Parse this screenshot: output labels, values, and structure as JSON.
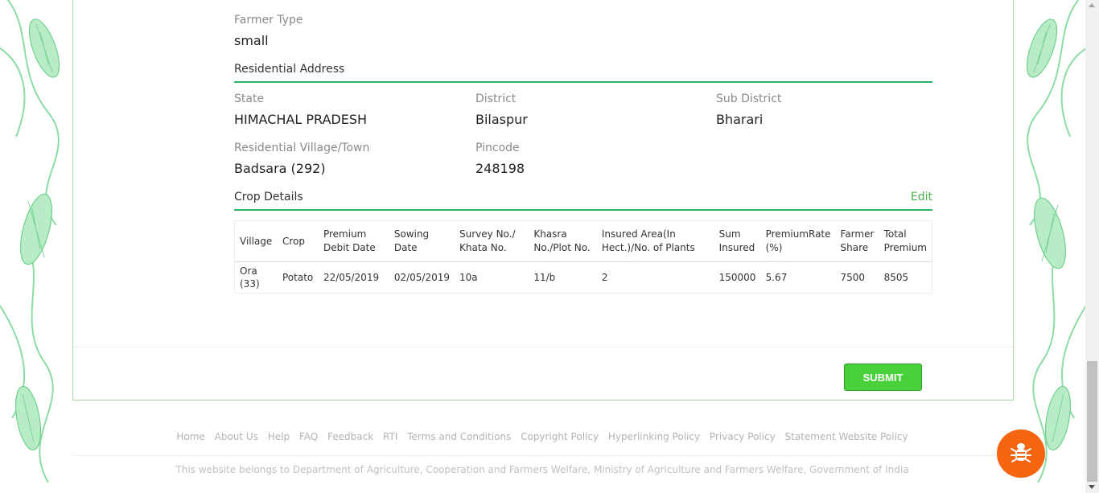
{
  "farmer": {
    "type_label": "Farmer Type",
    "type_value": "small"
  },
  "residential": {
    "title": "Residential Address",
    "state_label": "State",
    "state_value": "HIMACHAL PRADESH",
    "district_label": "District",
    "district_value": "Bilaspur",
    "subdistrict_label": "Sub District",
    "subdistrict_value": "Bharari",
    "village_label": "Residential Village/Town",
    "village_value": "Badsara (292)",
    "pincode_label": "Pincode",
    "pincode_value": "248198"
  },
  "crop": {
    "title": "Crop Details",
    "edit_label": "Edit",
    "headers": [
      "Village",
      "Crop",
      "Premium Debit Date",
      "Sowing Date",
      "Survey No./ Khata No.",
      "Khasra No./Plot No.",
      "Insured Area(In Hect.)/No. of Plants",
      "Sum Insured",
      "PremiumRate (%)",
      "Farmer Share",
      "Total Premium"
    ],
    "rows": [
      [
        "Ora (33)",
        "Potato",
        "22/05/2019",
        "02/05/2019",
        "10a",
        "11/b",
        "2",
        "150000",
        "5.67",
        "7500",
        "8505"
      ]
    ]
  },
  "actions": {
    "submit_label": "SUBMIT"
  },
  "footer": {
    "links": [
      "Home",
      "About Us",
      "Help",
      "FAQ",
      "Feedback",
      "RTI",
      "Terms and Conditions",
      "Copyright Policy",
      "Hyperlinking Policy",
      "Privacy Policy",
      "Statement Website Policy"
    ],
    "note": "This website belongs to Department of Agriculture, Cooperation and Farmers Welfare, Ministry of Agriculture and Farmers Welfare, Government of India"
  },
  "icons": {
    "bug": "bug-icon"
  },
  "colors": {
    "accent_green": "#2eb267",
    "submit_green": "#48d13a",
    "bug_orange": "#f5640f",
    "decor_green": "#7fd89a"
  }
}
